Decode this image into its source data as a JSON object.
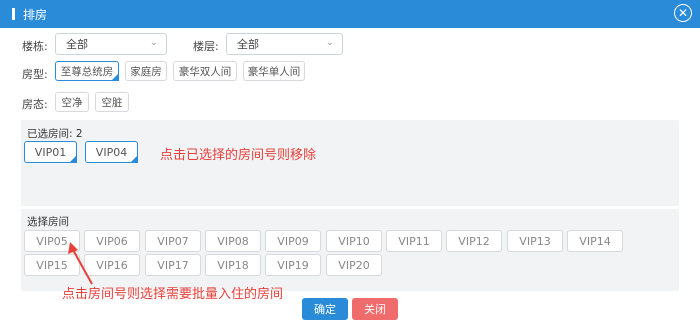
{
  "window": {
    "title": "排房",
    "close_symbol": "✕"
  },
  "filters": {
    "building": {
      "label": "楼栋:",
      "value": "全部"
    },
    "floor": {
      "label": "楼层:",
      "value": "全部"
    },
    "room_type": {
      "label": "房型:",
      "options": [
        "至尊总统房",
        "家庭房",
        "豪华双人间",
        "豪华单人间"
      ],
      "selected": "至尊总统房"
    },
    "room_state": {
      "label": "房态:",
      "options": [
        "空净",
        "空脏"
      ]
    }
  },
  "selected_panel": {
    "title": "已选房间:",
    "count": "2",
    "rooms": [
      "VIP01",
      "VIP04"
    ],
    "annotation": "点击已选择的房间号则移除"
  },
  "choose_panel": {
    "title": "选择房间",
    "rooms_row1": [
      "VIP05",
      "VIP06",
      "VIP07",
      "VIP08",
      "VIP09",
      "VIP10",
      "VIP11",
      "VIP12",
      "VIP13",
      "VIP14"
    ],
    "rooms_row2": [
      "VIP15",
      "VIP16",
      "VIP17",
      "VIP18",
      "VIP19",
      "VIP20"
    ],
    "annotation": "点击房间号则选择需要批量入住的房间"
  },
  "footer": {
    "confirm_label": "确定",
    "close_label": "关闭"
  },
  "colors": {
    "primary": "#2a8cd9",
    "danger": "#f06b6b",
    "annotation": "#e8403a"
  }
}
